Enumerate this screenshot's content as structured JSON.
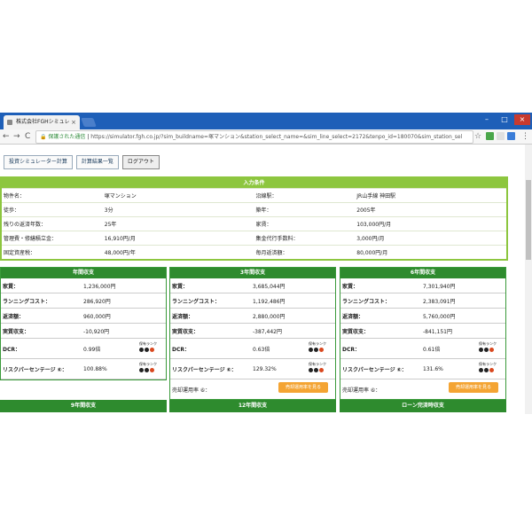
{
  "browser": {
    "tab_title": "株式会社FGHシミュレ",
    "tab_close": "×",
    "nav": {
      "back": "←",
      "forward": "→",
      "reload": "C"
    },
    "security_label": "保護された通信",
    "url": "https://simulator.fgh.co.jp/?sim_buildname=塚マンション&station_select_name=&sim_line_select=2172&tenpo_id=180070&sim_station_sel",
    "star": "☆",
    "menu": "⋮"
  },
  "toolbar": {
    "invest_sim": "投資シミュレーター計算",
    "calc_list": "計算結果一覧",
    "logout": "ログアウト"
  },
  "conditions": {
    "title": "入力条件",
    "rows": [
      {
        "l1": "物件名：",
        "v1": "塚マンション",
        "l2": "沿線駅：",
        "v2": "JR山手線 神田駅"
      },
      {
        "l1": "徒歩：",
        "v1": "3分",
        "l2": "築年：",
        "v2": "2005年"
      },
      {
        "l1": "残りの返済年数：",
        "v1": "25年",
        "l2": "家賃：",
        "v2": "103,000円/月"
      },
      {
        "l1": "管理費・修繕積立金：",
        "v1": "16,910円/月",
        "l2": "集金代行手数料：",
        "v2": "3,000円/月"
      },
      {
        "l1": "固定資産税：",
        "v1": "48,000円/年",
        "l2": "毎月返済額：",
        "v2": "80,000円/月"
      }
    ]
  },
  "labels": {
    "rent": "家賃：",
    "running": "ランニングコスト：",
    "repay": "返済額：",
    "actual": "実質収支：",
    "dcr": "DCR：",
    "risk": "リスクパーセンテージ ⑥：",
    "rank": "保有ランク",
    "sell": "売却運用率 ⑥：",
    "sell_btn": "売却運用率を見る"
  },
  "cards": [
    {
      "title": "年間収支",
      "rent": "1,236,000円",
      "running": "286,920円",
      "repay": "960,000円",
      "actual": "-10,920円",
      "dcr": "0.99倍",
      "risk": "100.88%",
      "sell": false
    },
    {
      "title": "3年間収支",
      "rent": "3,685,044円",
      "running": "1,192,486円",
      "repay": "2,880,000円",
      "actual": "-387,442円",
      "dcr": "0.63倍",
      "risk": "129.32%",
      "sell": true
    },
    {
      "title": "6年間収支",
      "rent": "7,301,940円",
      "running": "2,383,091円",
      "repay": "5,760,000円",
      "actual": "-841,151円",
      "dcr": "0.61倍",
      "risk": "131.6%",
      "sell": true
    }
  ],
  "bottom_headers": [
    "9年間収支",
    "12年間収支",
    "ローン完済時収支"
  ],
  "colors": {
    "accent": "#8dc63f",
    "card": "#2e8b2e",
    "lamp_dark": "#222222",
    "lamp_red": "#d9481f",
    "sell_btn": "#f4a433"
  }
}
